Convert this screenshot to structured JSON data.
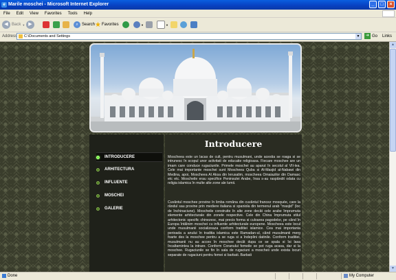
{
  "window": {
    "title": "Marile moschei - Microsoft Internet Explorer"
  },
  "menu": [
    "File",
    "Edit",
    "View",
    "Favorites",
    "Tools",
    "Help"
  ],
  "toolbar": {
    "back": "Back",
    "search": "Search",
    "favorites": "Favorites"
  },
  "address": {
    "label": "Address",
    "value": "C:\\Documents and Settings",
    "go": "Go",
    "links": "Links"
  },
  "nav": [
    {
      "label": "INTRODUCERE",
      "active": true
    },
    {
      "label": "ARHITECTURA",
      "active": false
    },
    {
      "label": "INFLUENTE",
      "active": false
    },
    {
      "label": "MOSCHEI",
      "active": false
    },
    {
      "label": "GALERIE",
      "active": false
    }
  ],
  "content": {
    "heading": "Introducere",
    "p1": "Moscheea este un lacas de cult, pentru musulmani, unde acestia se roaga si se intrunesc în scopul unor activitati de educatie religioasa. Fiecare moschee are un imam care conduce rugaciunile. Primele moschei au aparut în secolul al VII-lea. Cele mai importante moschei sunt Moscheea Quba si Al-Masjid al-Nabawi din Medina, apoi, Moscheea Al Aksa din Ierusalim, moscheea Omaiazilor din Damasc etc etc. Moscheile erau specifice Peninsulei Arabe, însa s-au raspândit odata cu religia islamica în multe alte zone ale lumii.",
    "p2": "Cuvântul moschee provine în limba româna din cuvântul francez mosquée, care la rândul sau provine prin mediere italiana si spaniola din termenul arab \"masjid\" (loc de închinaciune). Moscheile construite în alte zone decât cele arabe împrumuta elemente arhitecturale din zonele respective. Cele din China împrumuta stilul arhitectonic specific chinezesc, mai precis forma si culoarea pagodelor, pe când în Europa întâlnim moschei cu influente arhitecturale europene. Moscheea este locul unde musulmanii socializeaza conform traditiei islamice. Cea mai importanta perioada a anului în traditia islamica este Ramadan-ul, când musulmanii merg foarte des la moschee pentru a se ruga si a îndeplini datinile. Conform traditiei, musulmanii nu au acces în moschee decât dupa ce se spala si îsi lasa încaltamintea la intrare. Conform Coranului femeile se pot ruga acasa, dar si la moschee. Rugaciunile se fin în sala de rugaciuni a moscheii unde exista locuri separate de rugaciuni pentru femei si barbati. Barbati"
  },
  "status": {
    "left": "Done",
    "zone": "My Computer"
  }
}
